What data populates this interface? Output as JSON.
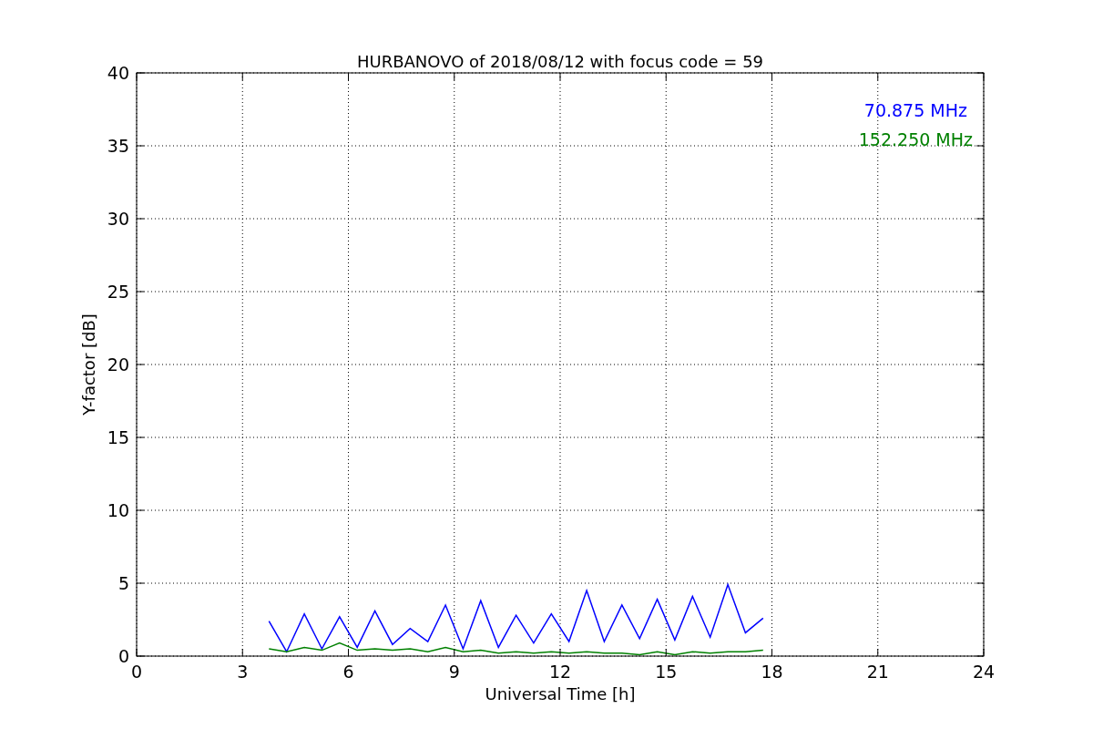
{
  "figure": {
    "chart_data": {
      "type": "line",
      "title": "HURBANOVO of 2018/08/12 with focus code = 59",
      "xlabel": "Universal Time [h]",
      "ylabel": "Y-factor [dB]",
      "grid": true,
      "xlim": [
        0,
        24
      ],
      "ylim": [
        0,
        40
      ],
      "xticks": [
        0,
        3,
        6,
        9,
        12,
        15,
        18,
        21,
        24
      ],
      "yticks": [
        0,
        5,
        10,
        15,
        20,
        25,
        30,
        35,
        40
      ],
      "x": [
        3.75,
        4.25,
        4.75,
        5.25,
        5.75,
        6.25,
        6.75,
        7.25,
        7.75,
        8.25,
        8.75,
        9.25,
        9.75,
        10.25,
        10.75,
        11.25,
        11.75,
        12.25,
        12.75,
        13.25,
        13.75,
        14.25,
        14.75,
        15.25,
        15.75,
        16.25,
        16.75,
        17.25,
        17.75
      ],
      "series": [
        {
          "name": "70.875 MHz",
          "color": "#0000ff",
          "values": [
            2.4,
            0.3,
            2.9,
            0.5,
            2.7,
            0.6,
            3.1,
            0.8,
            1.9,
            1.0,
            3.5,
            0.5,
            3.8,
            0.6,
            2.8,
            0.9,
            2.9,
            1.0,
            4.5,
            1.0,
            3.5,
            1.2,
            3.9,
            1.1,
            4.1,
            1.3,
            4.9,
            1.6,
            2.6
          ]
        },
        {
          "name": "152.250 MHz",
          "color": "#008000",
          "values": [
            0.5,
            0.3,
            0.6,
            0.4,
            0.9,
            0.4,
            0.5,
            0.4,
            0.5,
            0.3,
            0.6,
            0.3,
            0.4,
            0.2,
            0.3,
            0.2,
            0.3,
            0.2,
            0.3,
            0.2,
            0.2,
            0.1,
            0.3,
            0.1,
            0.3,
            0.2,
            0.3,
            0.3,
            0.4
          ]
        }
      ]
    }
  }
}
